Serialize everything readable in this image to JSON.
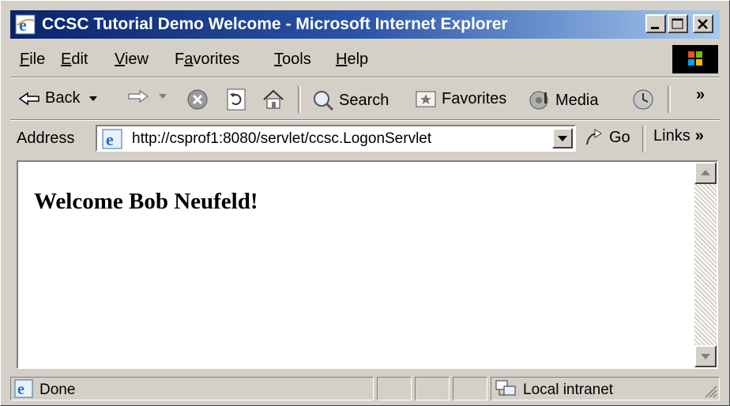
{
  "window": {
    "title": "CCSC Tutorial Demo Welcome - Microsoft Internet Explorer"
  },
  "menu": {
    "items": [
      "File",
      "Edit",
      "View",
      "Favorites",
      "Tools",
      "Help"
    ],
    "underline": [
      "F",
      "E",
      "V",
      "a",
      "T",
      "H"
    ]
  },
  "toolbar": {
    "back_label": "Back",
    "search_label": "Search",
    "favorites_label": "Favorites",
    "media_label": "Media",
    "more_label": "»"
  },
  "address": {
    "label": "Address",
    "url": "http://csprof1:8080/servlet/ccsc.LogonServlet",
    "go_label": "Go",
    "links_label": "Links",
    "links_more": "»"
  },
  "page": {
    "heading": "Welcome Bob Neufeld!"
  },
  "status": {
    "text": "Done",
    "zone": "Local intranet"
  },
  "colors": {
    "titlebar_start": "#0a246a",
    "titlebar_end": "#a6caf0",
    "chrome": "#d4d0c8"
  }
}
